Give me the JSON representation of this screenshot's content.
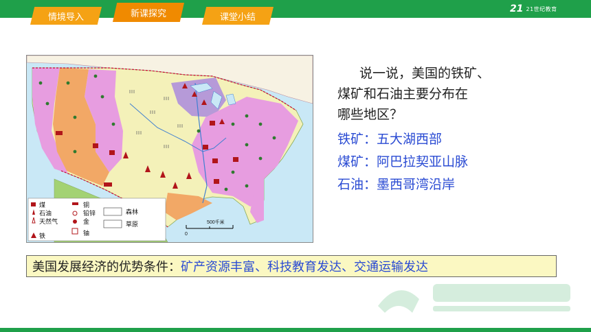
{
  "nav": {
    "tabs": [
      {
        "label": "情境导入",
        "active": false
      },
      {
        "label": "新课探究",
        "active": true
      },
      {
        "label": "课堂小结",
        "active": false
      }
    ],
    "logo": {
      "mark": "21",
      "text": "21世纪教育"
    }
  },
  "map": {
    "legend": {
      "coal": "煤",
      "oil": "石油",
      "gas": "天然气",
      "iron": "铁",
      "copper": "铜",
      "lead_zinc": "铅锌",
      "gold": "金",
      "uranium": "铀",
      "forest": "森林",
      "grassland": "草原"
    },
    "scale": {
      "zero": "0",
      "label": "500千米"
    }
  },
  "question": {
    "line1": "说一说，美国的铁矿、",
    "line2": "煤矿和石油主要分布在",
    "line3": "哪些地区？"
  },
  "answers": [
    {
      "text": "铁矿：五大湖西部"
    },
    {
      "text": "煤矿：阿巴拉契亚山脉"
    },
    {
      "text": "石油：墨西哥湾沿岸"
    }
  ],
  "summary": {
    "lead": "美国发展经济的优势条件：",
    "highlight": "矿产资源丰富、科技教育发达、交通运输发达"
  },
  "colors": {
    "topbar": "#1fa04a",
    "tab": "#f5a214",
    "answer": "#2a4bd3",
    "summary_bg": "#fbf8c2"
  }
}
